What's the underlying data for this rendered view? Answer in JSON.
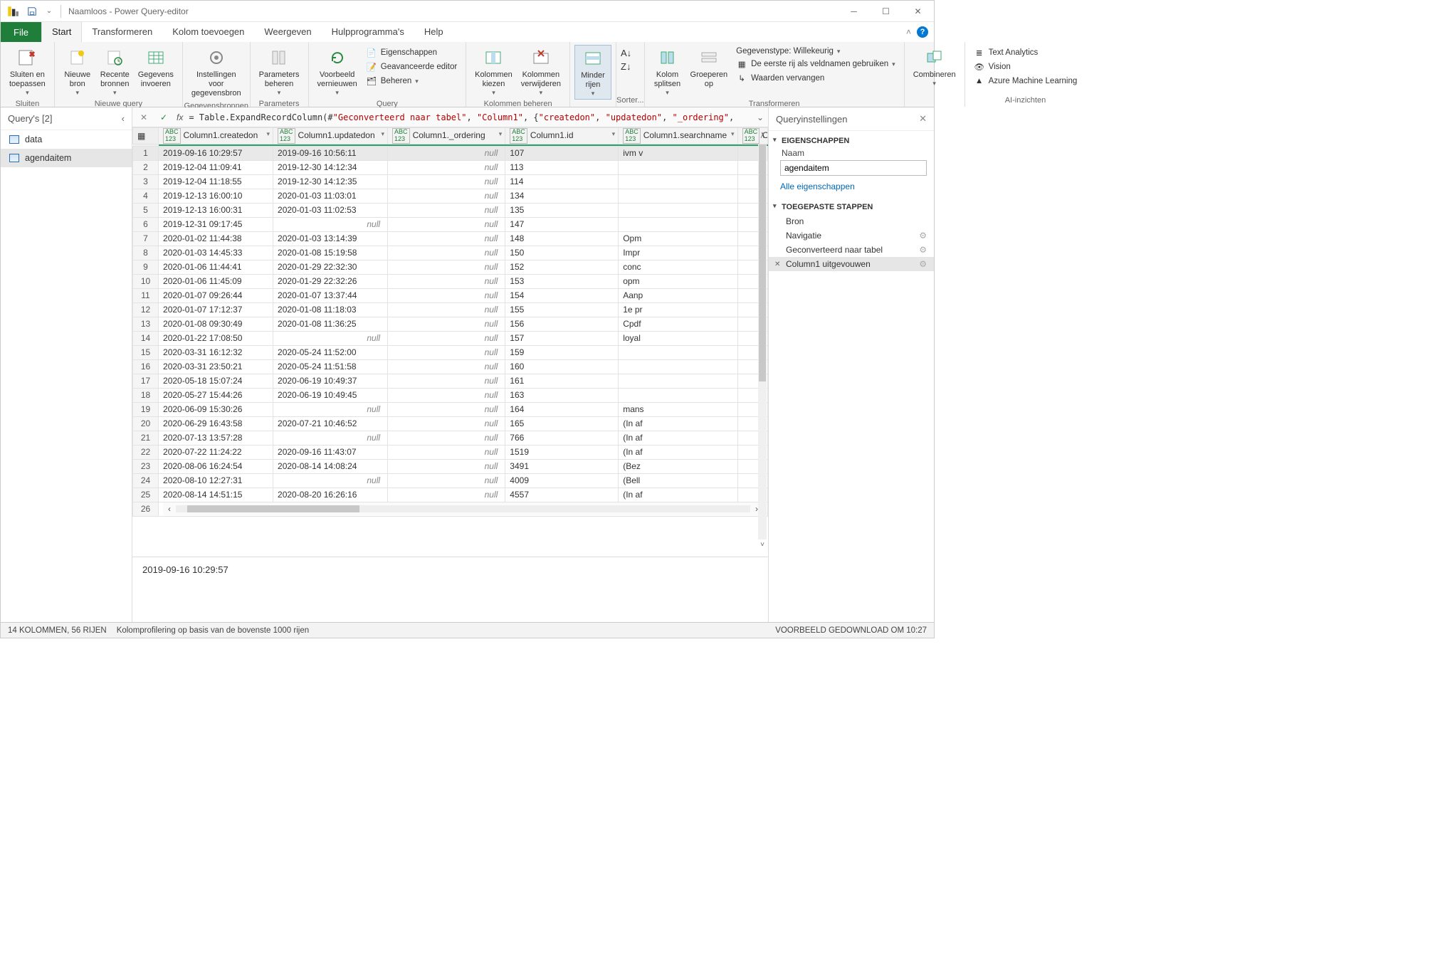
{
  "window": {
    "title": "Naamloos - Power Query-editor"
  },
  "tabs": {
    "file": "File",
    "items": [
      "Start",
      "Transformeren",
      "Kolom toevoegen",
      "Weergeven",
      "Hulpprogramma's",
      "Help"
    ],
    "active": 0
  },
  "ribbon": {
    "groups": {
      "sluiten": {
        "label": "Sluiten",
        "close_apply": "Sluiten en\ntoepassen"
      },
      "nieuwe_query": {
        "label": "Nieuwe query",
        "nieuwe_bron": "Nieuwe\nbron",
        "recente": "Recente\nbronnen",
        "gegevens": "Gegevens\ninvoeren"
      },
      "gegevensbronnen": {
        "label": "Gegevensbronnen",
        "instellingen": "Instellingen voor\ngegevensbron"
      },
      "parameters": {
        "label": "Parameters",
        "beheren": "Parameters\nbeheren"
      },
      "query": {
        "label": "Query",
        "vernieuwen": "Voorbeeld\nvernieuwen",
        "eigenschappen": "Eigenschappen",
        "geavanceerd": "Geavanceerde editor",
        "beheren": "Beheren"
      },
      "kolommen": {
        "label": "Kolommen beheren",
        "kiezen": "Kolommen\nkiezen",
        "verwijderen": "Kolommen\nverwijderen"
      },
      "rijen": {
        "label": "",
        "minder": "Minder\nrijen"
      },
      "sorteren": {
        "label": "Sorter..."
      },
      "transformeren": {
        "label": "Transformeren",
        "splitsen": "Kolom\nsplitsen",
        "groeperen": "Groeperen\nop",
        "gegevenstype": "Gegevenstype: Willekeurig",
        "eerste_rij": "De eerste rij als veldnamen gebruiken",
        "vervangen": "Waarden vervangen"
      },
      "combineren": {
        "label": "",
        "btn": "Combineren"
      },
      "ai": {
        "label": "AI-inzichten",
        "text": "Text Analytics",
        "vision": "Vision",
        "aml": "Azure Machine Learning"
      }
    }
  },
  "queries": {
    "header": "Query's [2]",
    "items": [
      "data",
      "agendaitem"
    ],
    "selected": 1
  },
  "formula": {
    "prefix": "= Table.ExpandRecordColumn(#",
    "s1": "\"Geconverteerd naar tabel\"",
    "s2": "\"Column1\"",
    "s3": "\"createdon\"",
    "s4": "\"updatedon\"",
    "s5": "\"_ordering\""
  },
  "columns": [
    {
      "name": "Column1.createdon",
      "type": "ABC\n123"
    },
    {
      "name": "Column1.updatedon",
      "type": "ABC\n123"
    },
    {
      "name": "Column1._ordering",
      "type": "ABC\n123"
    },
    {
      "name": "Column1.id",
      "type": "ABC\n123"
    },
    {
      "name": "Column1.searchname",
      "type": "ABC\n123"
    },
    {
      "name": "Colu",
      "type": "ABC\n123"
    }
  ],
  "rows": [
    {
      "n": 1,
      "created": "2019-09-16 10:29:57",
      "updated": "2019-09-16 10:56:11",
      "ordering": "null",
      "id": "107",
      "search": "ivm v"
    },
    {
      "n": 2,
      "created": "2019-12-04 11:09:41",
      "updated": "2019-12-30 14:12:34",
      "ordering": "null",
      "id": "113",
      "search": ""
    },
    {
      "n": 3,
      "created": "2019-12-04 11:18:55",
      "updated": "2019-12-30 14:12:35",
      "ordering": "null",
      "id": "114",
      "search": ""
    },
    {
      "n": 4,
      "created": "2019-12-13 16:00:10",
      "updated": "2020-01-03 11:03:01",
      "ordering": "null",
      "id": "134",
      "search": ""
    },
    {
      "n": 5,
      "created": "2019-12-13 16:00:31",
      "updated": "2020-01-03 11:02:53",
      "ordering": "null",
      "id": "135",
      "search": ""
    },
    {
      "n": 6,
      "created": "2019-12-31 09:17:45",
      "updated": "null",
      "ordering": "null",
      "id": "147",
      "search": ""
    },
    {
      "n": 7,
      "created": "2020-01-02 11:44:38",
      "updated": "2020-01-03 13:14:39",
      "ordering": "null",
      "id": "148",
      "search": "Opm"
    },
    {
      "n": 8,
      "created": "2020-01-03 14:45:33",
      "updated": "2020-01-08 15:19:58",
      "ordering": "null",
      "id": "150",
      "search": "Impr"
    },
    {
      "n": 9,
      "created": "2020-01-06 11:44:41",
      "updated": "2020-01-29 22:32:30",
      "ordering": "null",
      "id": "152",
      "search": "conc"
    },
    {
      "n": 10,
      "created": "2020-01-06 11:45:09",
      "updated": "2020-01-29 22:32:26",
      "ordering": "null",
      "id": "153",
      "search": "opm"
    },
    {
      "n": 11,
      "created": "2020-01-07 09:26:44",
      "updated": "2020-01-07 13:37:44",
      "ordering": "null",
      "id": "154",
      "search": "Aanp"
    },
    {
      "n": 12,
      "created": "2020-01-07 17:12:37",
      "updated": "2020-01-08 11:18:03",
      "ordering": "null",
      "id": "155",
      "search": "1e pr"
    },
    {
      "n": 13,
      "created": "2020-01-08 09:30:49",
      "updated": "2020-01-08 11:36:25",
      "ordering": "null",
      "id": "156",
      "search": "Cpdf"
    },
    {
      "n": 14,
      "created": "2020-01-22 17:08:50",
      "updated": "null",
      "ordering": "null",
      "id": "157",
      "search": "loyal"
    },
    {
      "n": 15,
      "created": "2020-03-31 16:12:32",
      "updated": "2020-05-24 11:52:00",
      "ordering": "null",
      "id": "159",
      "search": ""
    },
    {
      "n": 16,
      "created": "2020-03-31 23:50:21",
      "updated": "2020-05-24 11:51:58",
      "ordering": "null",
      "id": "160",
      "search": ""
    },
    {
      "n": 17,
      "created": "2020-05-18 15:07:24",
      "updated": "2020-06-19 10:49:37",
      "ordering": "null",
      "id": "161",
      "search": ""
    },
    {
      "n": 18,
      "created": "2020-05-27 15:44:26",
      "updated": "2020-06-19 10:49:45",
      "ordering": "null",
      "id": "163",
      "search": ""
    },
    {
      "n": 19,
      "created": "2020-06-09 15:30:26",
      "updated": "null",
      "ordering": "null",
      "id": "164",
      "search": "mans"
    },
    {
      "n": 20,
      "created": "2020-06-29 16:43:58",
      "updated": "2020-07-21 10:46:52",
      "ordering": "null",
      "id": "165",
      "search": "(In af"
    },
    {
      "n": 21,
      "created": "2020-07-13 13:57:28",
      "updated": "null",
      "ordering": "null",
      "id": "766",
      "search": "(In af"
    },
    {
      "n": 22,
      "created": "2020-07-22 11:24:22",
      "updated": "2020-09-16 11:43:07",
      "ordering": "null",
      "id": "1519",
      "search": "(In af"
    },
    {
      "n": 23,
      "created": "2020-08-06 16:24:54",
      "updated": "2020-08-14 14:08:24",
      "ordering": "null",
      "id": "3491",
      "search": "(Bez"
    },
    {
      "n": 24,
      "created": "2020-08-10 12:27:31",
      "updated": "null",
      "ordering": "null",
      "id": "4009",
      "search": "(Bell"
    },
    {
      "n": 25,
      "created": "2020-08-14 14:51:15",
      "updated": "2020-08-20 16:26:16",
      "ordering": "null",
      "id": "4557",
      "search": "(In af"
    },
    {
      "n": 26,
      "created": "",
      "updated": "",
      "ordering": "",
      "id": "",
      "search": "",
      "hscroll": true
    }
  ],
  "cell_preview": "2019-09-16 10:29:57",
  "settings": {
    "title": "Queryinstellingen",
    "props_h": "EIGENSCHAPPEN",
    "name_label": "Naam",
    "name_value": "agendaitem",
    "all_props": "Alle eigenschappen",
    "steps_h": "TOEGEPASTE STAPPEN",
    "steps": [
      {
        "label": "Bron",
        "gear": false
      },
      {
        "label": "Navigatie",
        "gear": true
      },
      {
        "label": "Geconverteerd naar tabel",
        "gear": true
      },
      {
        "label": "Column1 uitgevouwen",
        "gear": true,
        "selected": true
      }
    ]
  },
  "status": {
    "left1": "14 KOLOMMEN, 56 RIJEN",
    "left2": "Kolomprofilering op basis van de bovenste 1000 rijen",
    "right": "VOORBEELD GEDOWNLOAD OM 10:27"
  }
}
